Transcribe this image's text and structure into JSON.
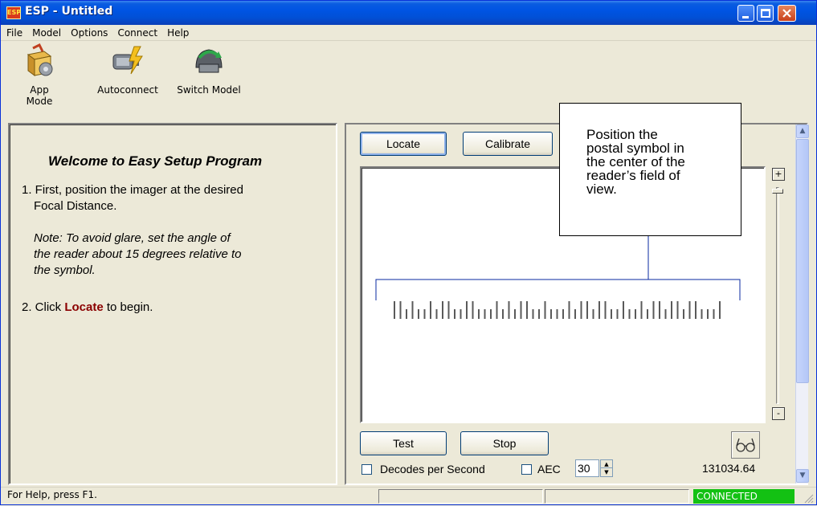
{
  "window": {
    "title": "ESP - Untitled",
    "app_icon_text": "ESP"
  },
  "menu": [
    "File",
    "Model",
    "Options",
    "Connect",
    "Help"
  ],
  "toolbar": {
    "app_mode_label": "App Mode",
    "autoconnect_label": "Autoconnect",
    "switch_model_label": "Switch Model"
  },
  "welcome": {
    "title": "Welcome to Easy Setup Program",
    "step1_line1": "1. First, position the imager at the desired",
    "step1_line2": "Focal Distance.",
    "note_line1": "Note: To avoid glare, set the angle of",
    "note_line2": "the reader about 15 degrees relative to",
    "note_line3": "the symbol.",
    "step2_prefix": "2. Click ",
    "step2_keyword": "Locate",
    "step2_suffix": " to begin."
  },
  "controls": {
    "locate_label": "Locate",
    "calibrate_label": "Calibrate",
    "test_label": "Test",
    "stop_label": "Stop",
    "decodes_per_second_label": "Decodes per Second",
    "aec_label": "AEC",
    "aec_value": "30",
    "zoom_in_label": "+",
    "zoom_out_label": "-",
    "reading_value": "131034.64"
  },
  "callout": {
    "line1": "Position the",
    "line2": "postal symbol in",
    "line3": "the center of the",
    "line4": "reader’s field of",
    "line5": "view."
  },
  "status": {
    "help_text": "For Help, press F1.",
    "connection": "CONNECTED"
  },
  "colors": {
    "title_bar": "#0054e3",
    "connected_bg": "#13c113",
    "locate_keyword": "#8b0000"
  },
  "icons": [
    "app-mode-icon",
    "autoconnect-icon",
    "switch-model-icon",
    "glasses-icon",
    "minimize-icon",
    "maximize-icon",
    "close-icon"
  ]
}
